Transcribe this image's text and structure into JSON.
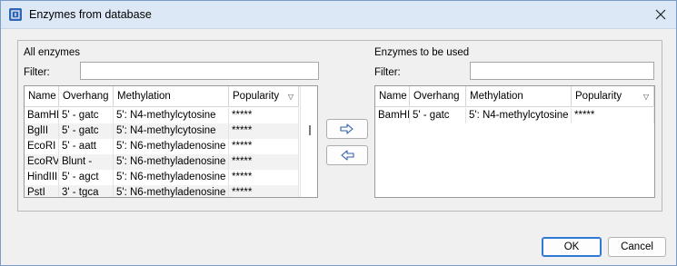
{
  "window": {
    "title": "Enzymes from database",
    "app_icon": "app-icon",
    "close_icon": "close-icon"
  },
  "left": {
    "section_label": "All enzymes",
    "filter_label": "Filter:",
    "filter_value": "",
    "columns": [
      "Name",
      "Overhang",
      "Methylation",
      "Popularity"
    ],
    "rows": [
      [
        "BamHI",
        "5' - gatc",
        "5': N4-methylcytosine",
        "*****"
      ],
      [
        "BglII",
        "5' - gatc",
        "5': N4-methylcytosine",
        "*****"
      ],
      [
        "EcoRI",
        "5' - aatt",
        "5': N6-methyladenosine",
        "*****"
      ],
      [
        "EcoRV",
        "Blunt -",
        "5': N6-methyladenosine",
        "*****"
      ],
      [
        "HindIII",
        "5' - agct",
        "5': N6-methyladenosine",
        "*****"
      ],
      [
        "PstI",
        "3' - tgca",
        "5': N6-methyladenosine",
        "*****"
      ]
    ]
  },
  "right": {
    "section_label": "Enzymes to be used",
    "filter_label": "Filter:",
    "filter_value": "",
    "columns": [
      "Name",
      "Overhang",
      "Methylation",
      "Popularity"
    ],
    "rows": [
      [
        "BamHI",
        "5' - gatc",
        "5': N4-methylcytosine",
        "*****"
      ]
    ]
  },
  "buttons": {
    "ok": "OK",
    "cancel": "Cancel",
    "add_icon": "arrow-right-icon",
    "remove_icon": "arrow-left-icon"
  },
  "colors": {
    "titlebar": "#dde8f6",
    "accent": "#2f78d7"
  }
}
